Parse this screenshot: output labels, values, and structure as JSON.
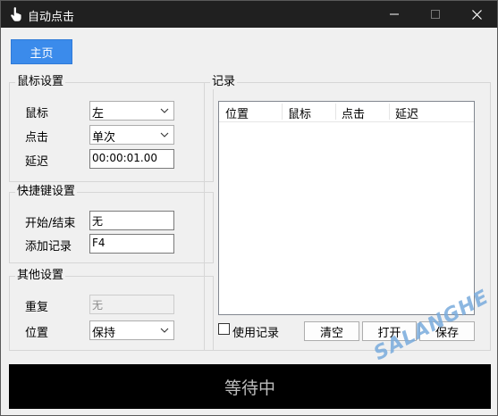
{
  "window": {
    "title": "自动点击",
    "minimize_icon": "minimize-icon",
    "maximize_icon": "maximize-icon",
    "close_icon": "close-icon"
  },
  "home_button": "主页",
  "mouse_settings": {
    "title": "鼠标设置",
    "button_label": "鼠标",
    "button_value": "左",
    "click_label": "点击",
    "click_value": "单次",
    "delay_label": "延迟",
    "delay_value": "00:00:01.00"
  },
  "hotkey_settings": {
    "title": "快捷键设置",
    "start_stop_label": "开始/结束",
    "start_stop_value": "无",
    "add_record_label": "添加记录",
    "add_record_value": "F4"
  },
  "other_settings": {
    "title": "其他设置",
    "repeat_label": "重复",
    "repeat_value": "无",
    "position_label": "位置",
    "position_value": "保持"
  },
  "records": {
    "title": "记录",
    "columns": [
      "位置",
      "鼠标",
      "点击",
      "延迟"
    ],
    "use_records_label": "使用记录",
    "use_records_checked": false,
    "clear_label": "清空",
    "open_label": "打开",
    "save_label": "保存"
  },
  "status_text": "等待中",
  "watermark_text": "SALANGHE",
  "colors": {
    "titlebar": "#202020",
    "accent_button": "#3b8beb",
    "status_bar": "#000000",
    "status_text": "#bdbdbd"
  }
}
